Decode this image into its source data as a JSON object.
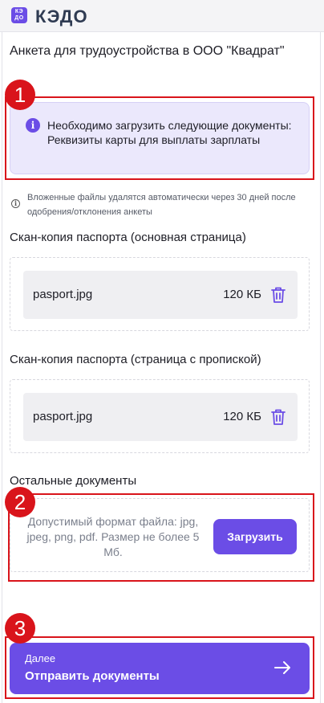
{
  "app": {
    "logo_badge": "КЭ ДО",
    "logo_text": "КЭДО"
  },
  "page": {
    "title": "Анкета для трудоустройства в ООО \"Квадрат\""
  },
  "alert": {
    "line1": "Необходимо загрузить следующие документы:",
    "line2": "Реквизиты карты для выплаты зарплаты"
  },
  "note": "Вложенные файлы удалятся автоматически через 30 дней после одобрения/отклонения анкеты",
  "sections": [
    {
      "title": "Скан-копия паспорта (основная страница)",
      "file": {
        "name": "pasport.jpg",
        "size": "120 КБ"
      }
    },
    {
      "title": "Скан-копия паспорта (страница с пропиской)",
      "file": {
        "name": "pasport.jpg",
        "size": "120 КБ"
      }
    }
  ],
  "other_docs": {
    "title": "Остальные документы",
    "hint": "Допустимый формат файла: jpg, jpeg, png, pdf. Размер не более 5 Мб.",
    "upload_label": "Загрузить"
  },
  "next": {
    "small": "Далее",
    "main": "Отправить документы"
  },
  "annotations": [
    "1",
    "2",
    "3"
  ],
  "colors": {
    "accent": "#6b4de6",
    "annotation": "#d9141b",
    "alert_bg": "#ebe8fc"
  }
}
